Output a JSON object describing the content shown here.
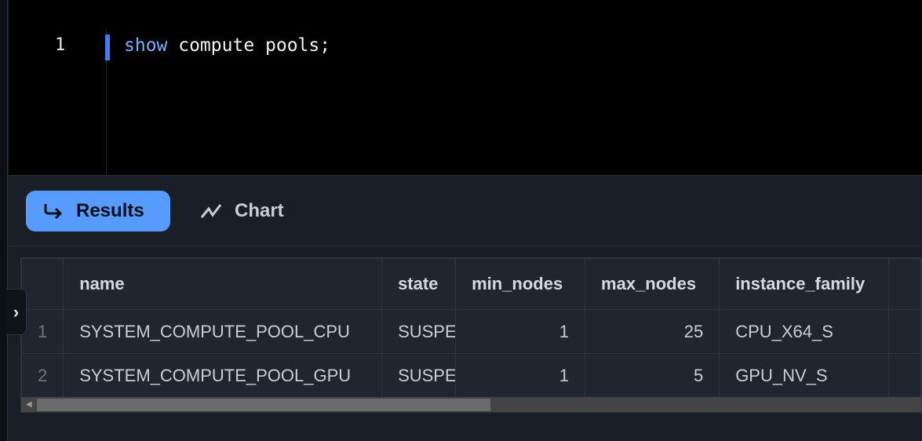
{
  "editor": {
    "line_number": "1",
    "keyword": "show",
    "code_rest": " compute pools;"
  },
  "tabs": [
    {
      "label": "Results",
      "icon": "return-arrow-icon",
      "active": true
    },
    {
      "label": "Chart",
      "icon": "line-chart-icon",
      "active": false
    }
  ],
  "table": {
    "columns": [
      "",
      "name",
      "state",
      "min_nodes",
      "max_nodes",
      "instance_family"
    ],
    "rows": [
      {
        "n": "1",
        "name": "SYSTEM_COMPUTE_POOL_CPU",
        "state": "SUSPE",
        "min_nodes": "1",
        "max_nodes": "25",
        "instance_family": "CPU_X64_S"
      },
      {
        "n": "2",
        "name": "SYSTEM_COMPUTE_POOL_GPU",
        "state": "SUSPE",
        "min_nodes": "1",
        "max_nodes": "5",
        "instance_family": "GPU_NV_S"
      }
    ]
  },
  "colors": {
    "accent": "#589bff",
    "editor_bg": "#000000",
    "keyword": "#7eaefc"
  }
}
